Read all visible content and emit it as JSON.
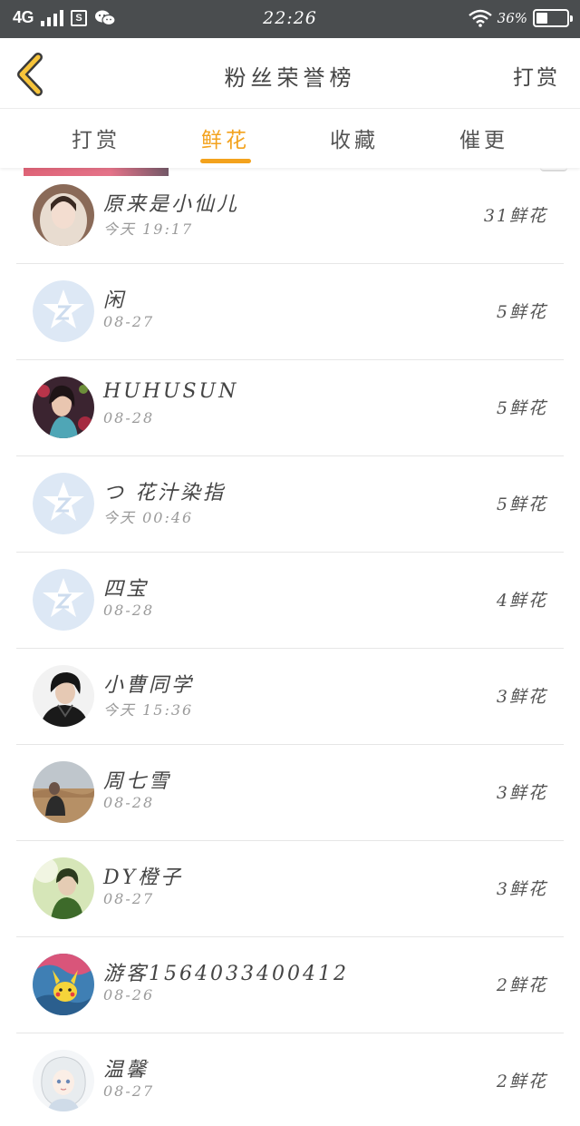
{
  "status_bar": {
    "network": "4G",
    "time": "22:26",
    "battery_percent": "36%",
    "battery_level": 0.36
  },
  "header": {
    "back_icon": "chevron-left-icon",
    "title": "粉丝荣誉榜",
    "right_action": "打赏"
  },
  "tabs": [
    {
      "label": "打赏",
      "active": false
    },
    {
      "label": "鲜花",
      "active": true
    },
    {
      "label": "收藏",
      "active": false
    },
    {
      "label": "催更",
      "active": false
    }
  ],
  "colors": {
    "accent": "#f3a21d",
    "status_bar": "#4a4d4f",
    "default_avatar": "#dde8f5"
  },
  "fans": [
    {
      "name": "原来是小仙儿",
      "date": "今天 19:17",
      "amount": "31鲜花",
      "avatar": "photo-girl-hood"
    },
    {
      "name": "闲",
      "date": "08-27",
      "amount": "5鲜花",
      "avatar": "default-avatar"
    },
    {
      "name": "HUHUSUN",
      "date": "08-28",
      "amount": "5鲜花",
      "avatar": "photo-woman-flowers"
    },
    {
      "name": "つ 花汁染指",
      "date": "今天 00:46",
      "amount": "5鲜花",
      "avatar": "default-avatar"
    },
    {
      "name": "四宝",
      "date": "08-28",
      "amount": "4鲜花",
      "avatar": "default-avatar"
    },
    {
      "name": "小曹同学",
      "date": "今天 15:36",
      "amount": "3鲜花",
      "avatar": "photo-boy-dark"
    },
    {
      "name": "周七雪",
      "date": "08-28",
      "amount": "3鲜花",
      "avatar": "photo-field"
    },
    {
      "name": "DY橙子",
      "date": "08-27",
      "amount": "3鲜花",
      "avatar": "photo-green"
    },
    {
      "name": "游客1564033400412",
      "date": "08-26",
      "amount": "2鲜花",
      "avatar": "photo-pikachu"
    },
    {
      "name": "温馨",
      "date": "08-27",
      "amount": "2鲜花",
      "avatar": "photo-anime-girl"
    }
  ]
}
